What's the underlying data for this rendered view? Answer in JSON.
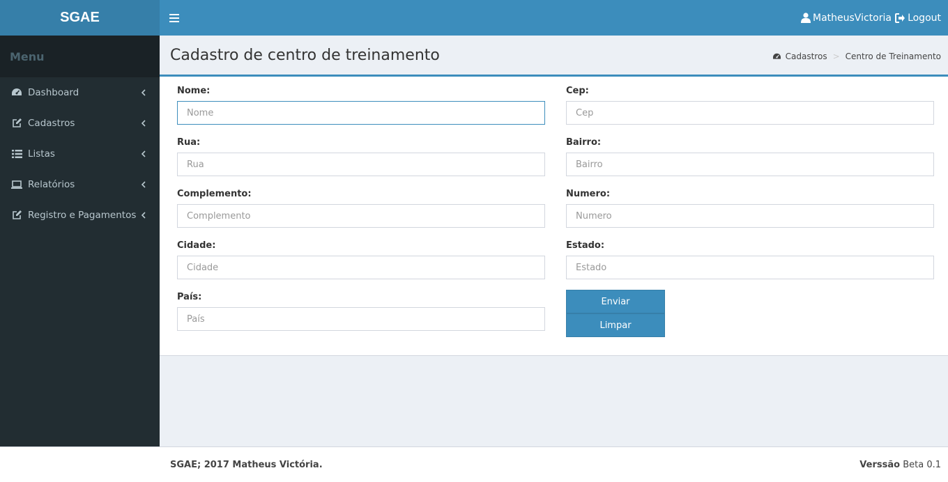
{
  "app": {
    "logo": "SGAE"
  },
  "navbar": {
    "user_name": "MatheusVictoria",
    "logout_label": "Logout"
  },
  "sidebar": {
    "header": "Menu",
    "items": [
      {
        "label": "Dashboard",
        "icon": "dashboard-icon"
      },
      {
        "label": "Cadastros",
        "icon": "edit-icon"
      },
      {
        "label": "Listas",
        "icon": "list-icon"
      },
      {
        "label": "Relatórios",
        "icon": "laptop-icon"
      },
      {
        "label": "Registro e Pagamentos",
        "icon": "edit-icon"
      }
    ]
  },
  "page": {
    "title": "Cadastro de centro de treinamento",
    "breadcrumb": {
      "first": "Cadastros",
      "separator": ">",
      "current": "Centro de Treinamento"
    }
  },
  "form": {
    "nome": {
      "label": "Nome:",
      "placeholder": "Nome",
      "value": ""
    },
    "cep": {
      "label": "Cep:",
      "placeholder": "Cep",
      "value": ""
    },
    "rua": {
      "label": "Rua:",
      "placeholder": "Rua",
      "value": ""
    },
    "bairro": {
      "label": "Bairro:",
      "placeholder": "Bairro",
      "value": ""
    },
    "complemento": {
      "label": "Complemento:",
      "placeholder": "Complemento",
      "value": ""
    },
    "numero": {
      "label": "Numero:",
      "placeholder": "Numero",
      "value": ""
    },
    "cidade": {
      "label": "Cidade:",
      "placeholder": "Cidade",
      "value": ""
    },
    "estado": {
      "label": "Estado:",
      "placeholder": "Estado",
      "value": ""
    },
    "pais": {
      "label": "País:",
      "placeholder": "País",
      "value": ""
    },
    "submit_label": "Enviar",
    "clear_label": "Limpar"
  },
  "footer": {
    "copyright": "SGAE; 2017 Matheus Victória.",
    "version_label": "Verssão",
    "version_value": "Beta 0.1"
  },
  "colors": {
    "primary": "#3c8dbc",
    "primary_dark": "#367fa9",
    "sidebar": "#222d32",
    "sidebar_header": "#1a2226",
    "content_bg": "#ecf0f5"
  }
}
